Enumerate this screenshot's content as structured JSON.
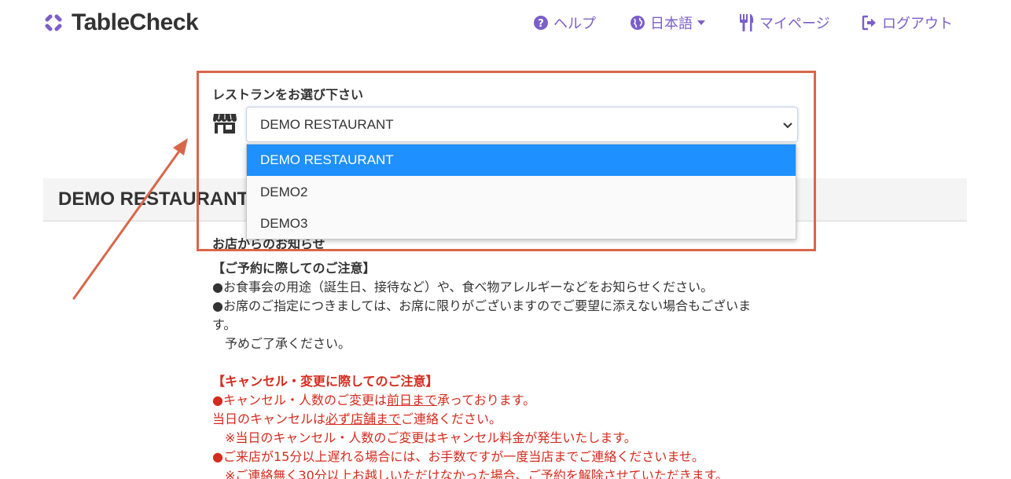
{
  "header": {
    "brand": "TableCheck",
    "nav": {
      "help": "ヘルプ",
      "language": "日本語",
      "mypage": "マイページ",
      "logout": "ログアウト"
    }
  },
  "restaurant_select": {
    "label": "レストランをお選び下さい",
    "value": "DEMO RESTAURANT",
    "options": [
      "DEMO RESTAURANT",
      "DEMO2",
      "DEMO3"
    ],
    "selected_index": 0
  },
  "section": {
    "title": "DEMO RESTAURANT",
    "notice_title": "お店からのお知らせ"
  },
  "notice": {
    "reservation_heading": "【ご予約に際してのご注意】",
    "reservation_lines": [
      "●お食事会の用途（誕生日、接待など）や、食べ物アレルギーなどをお知らせください。",
      "●お席のご指定につきましては、お席に限りがございますのでご要望に添えない場合もございま",
      "す。",
      "　予めご了承ください。"
    ],
    "cancel_heading": "【キャンセル・変更に際してのご注意】",
    "cancel_line1_a": "キャンセル・人数のご変更は",
    "cancel_line1_u": "前日まで",
    "cancel_line1_b": "承っております。",
    "cancel_line2_a": "当日のキャンセルは",
    "cancel_line2_u": "必ず店舗まで",
    "cancel_line2_b": "ご連絡ください。",
    "cancel_line3": "　※当日のキャンセル・人数のご変更はキャンセル料金が発生いたします。",
    "cancel_line4": "●ご来店が15分以上遅れる場合には、お手数ですが一度当店までご連絡くださいませ。",
    "cancel_line5": "　※ご連絡無く30分以上お越しいただけなかった場合、ご予約を解除させていただきます。"
  },
  "colors": {
    "accent": "#7b5fc9",
    "highlight_box": "#d8674a",
    "selected_option": "#1e90ff",
    "notice_red": "#d52b1e"
  }
}
